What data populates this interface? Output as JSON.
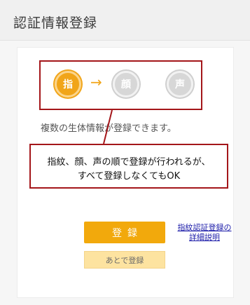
{
  "header": {
    "title": "認証情報登録"
  },
  "steps": {
    "items": [
      {
        "label": "指",
        "state": "active"
      },
      {
        "label": "顔",
        "state": "inactive"
      },
      {
        "label": "声",
        "state": "inactive"
      }
    ],
    "arrow": "→"
  },
  "info_text": "複数の生体情報が登録できます。",
  "note": {
    "line1": "指紋、顔、声の順で登録が行われるが、",
    "line2": "すべて登録しなくてもOK"
  },
  "buttons": {
    "register_label": "登録",
    "later_label": "あとで登録"
  },
  "detail_link": {
    "line1": "指紋認証登録の",
    "line2": "詳細説明"
  },
  "colors": {
    "accent": "#f2a90c",
    "accent_light": "#fde3a0",
    "callout": "#a4161a",
    "link": "#1a1aa8",
    "inactive": "#d7d7d7"
  }
}
